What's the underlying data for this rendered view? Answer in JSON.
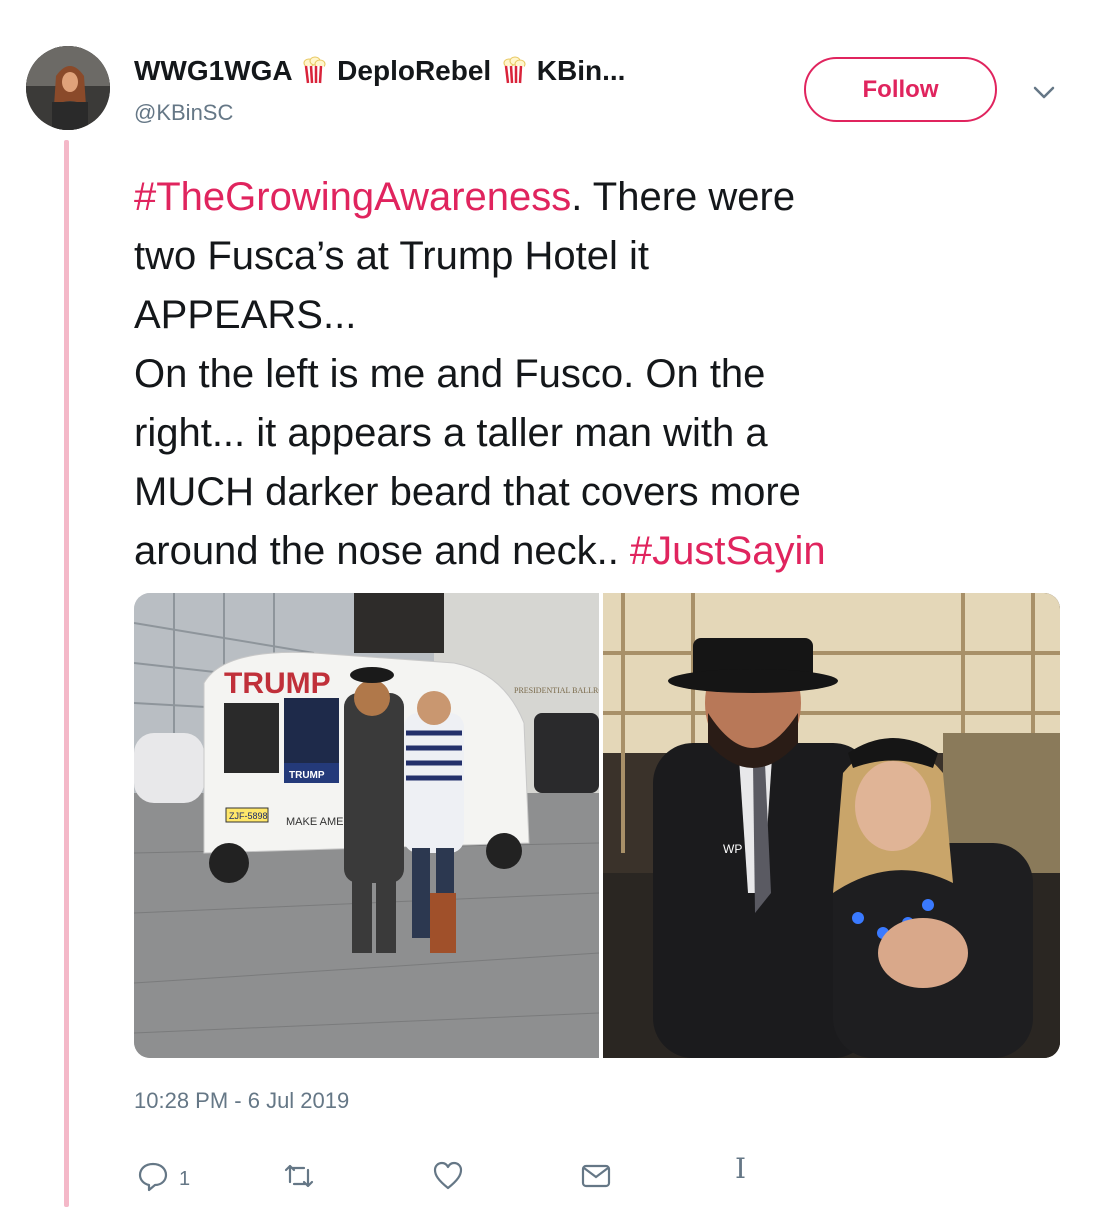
{
  "user": {
    "display_name_parts": [
      "WWG1WGA",
      "DeploRebel",
      "KBin..."
    ],
    "name_emoji": "popcorn-icon",
    "handle": "@KBinSC"
  },
  "follow_button": {
    "label": "Follow"
  },
  "tweet": {
    "lines": [
      {
        "hashtag": "#TheGrowingAwareness",
        "text": ". There were"
      },
      {
        "text": "two Fusca’s at Trump Hotel it"
      },
      {
        "text": "APPEARS..."
      },
      {
        "text": "On the left is me and Fusco. On the"
      },
      {
        "text": "right... it appears a taller man with a"
      },
      {
        "text": "MUCH darker beard that covers more"
      },
      {
        "text": "around the nose and neck.. ",
        "hashtag": "#JustSayin"
      }
    ]
  },
  "media": {
    "left_photo": {
      "van_text": "TRUMP",
      "sign_text": "TRUMP",
      "bumper_text": "MAKE AME GREAT AG",
      "plate": "ZJF-5898",
      "building_text": "PRESIDENTIAL BALLROO"
    },
    "right_photo": {
      "badge_text": "WP"
    }
  },
  "timestamp": "10:28 PM - 6 Jul 2019",
  "actions": {
    "reply_count": "1",
    "retweet_count": "",
    "like_count": ""
  },
  "icons": [
    "chevron-down-icon",
    "reply-icon",
    "retweet-icon",
    "heart-icon",
    "envelope-icon",
    "text-cursor-icon"
  ],
  "colors": {
    "accent": "#e0245e",
    "thread_line": "#f4b8c8",
    "secondary_text": "#657786"
  }
}
